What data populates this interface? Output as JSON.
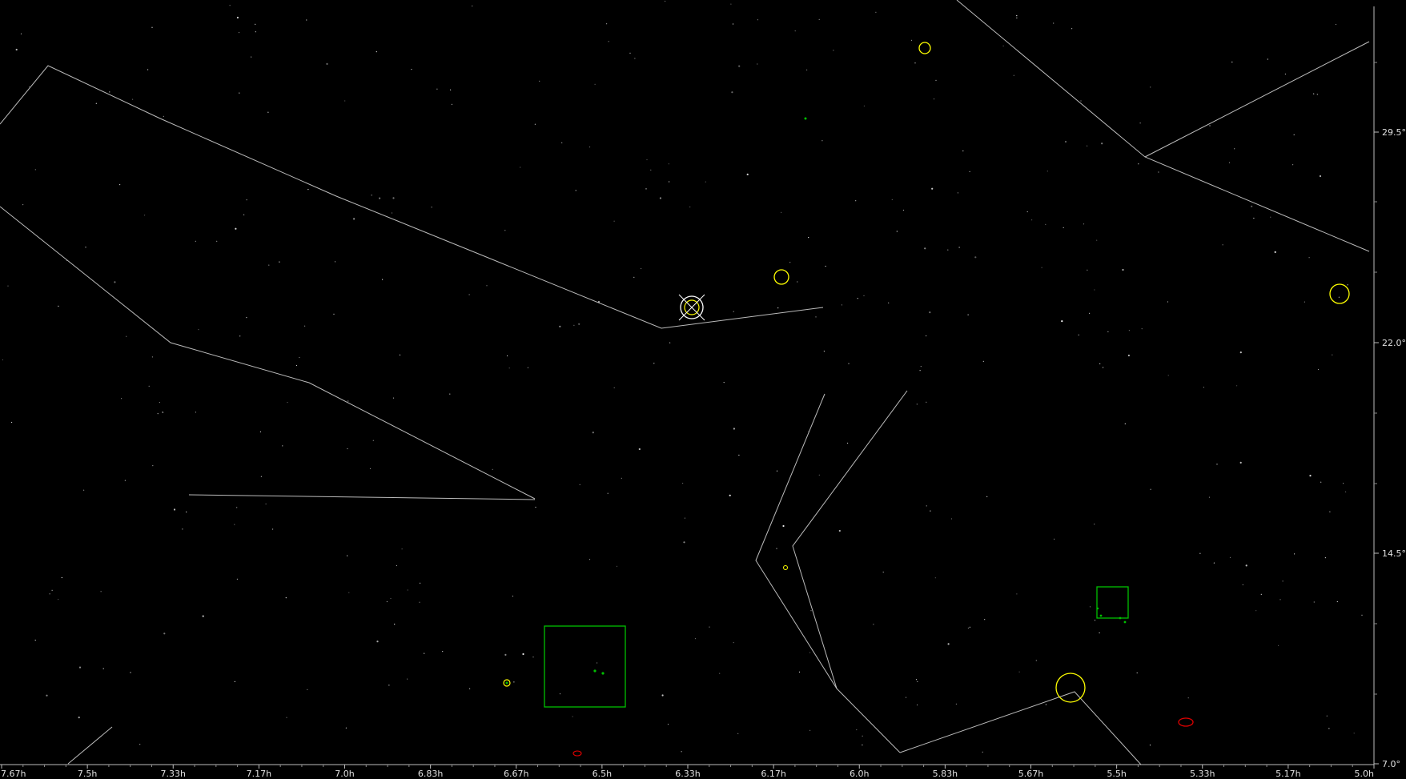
{
  "window_title": "",
  "ra_axis": {
    "labels": [
      "7.67h",
      "7.5h",
      "7.33h",
      "7.17h",
      "7.0h",
      "6.83h",
      "6.67h",
      "6.5h",
      "6.33h",
      "6.17h",
      "6.0h",
      "5.83h",
      "5.67h",
      "5.5h",
      "5.33h",
      "5.17h",
      "5.0h"
    ],
    "range": [
      "7.67h",
      "5.0h"
    ]
  },
  "dec_axis": {
    "labels": [
      "29.5°",
      "22.0°",
      "14.5°",
      "7.0°"
    ],
    "range_deg": [
      7.0,
      33.0
    ]
  },
  "colors": {
    "background": "#000000",
    "constellation_lines": "#cfcfcf",
    "star": "#ffffff",
    "planet_marker": "#ffff00",
    "cluster_marker": "#00c000",
    "galaxy_marker": "#e00000",
    "target_marker": "#ffffff"
  },
  "legend_icons": {
    "yellow_circle": "open-cluster-or-planet-icon",
    "green_square": "open-cluster-icon",
    "red_ellipse": "galaxy-icon",
    "crosshair": "target-crosshair-icon"
  }
}
